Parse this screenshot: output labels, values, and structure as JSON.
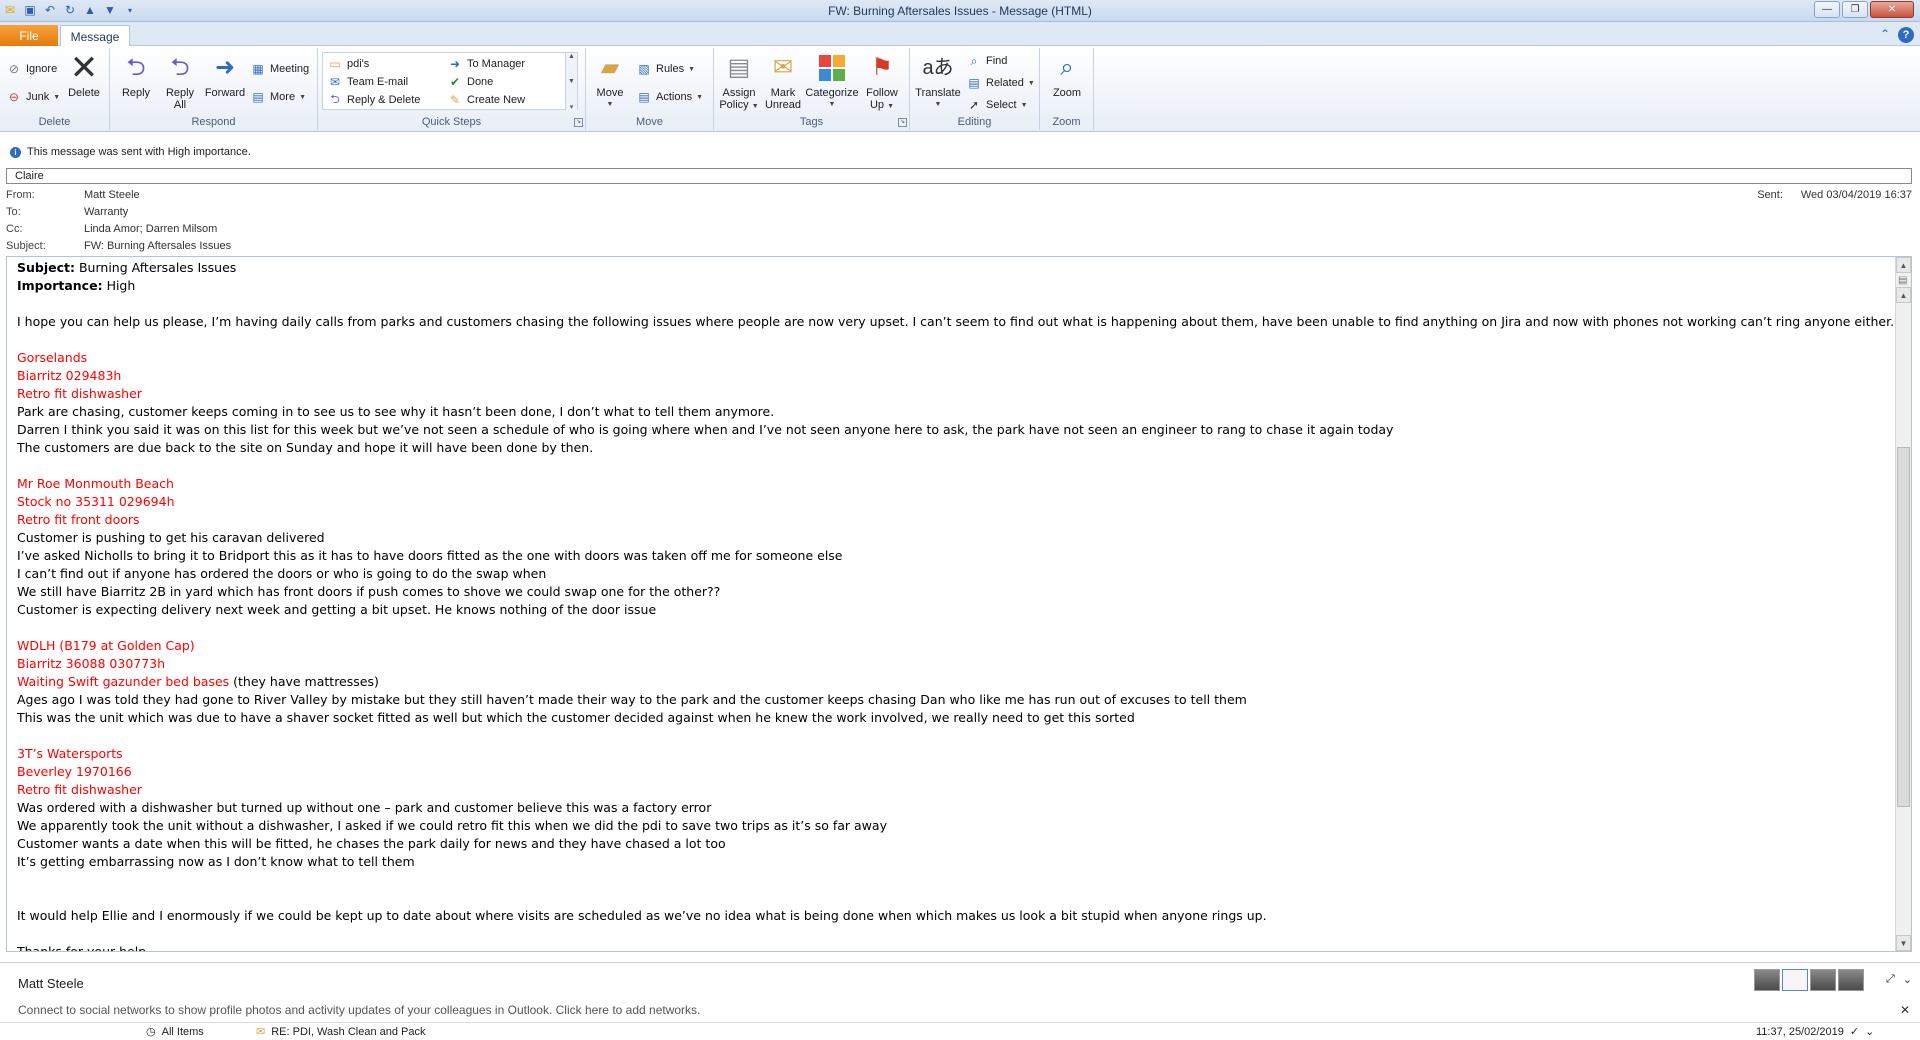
{
  "window": {
    "title": "FW: Burning Aftersales Issues  -  Message (HTML)"
  },
  "tabs": {
    "file": "File",
    "message": "Message"
  },
  "ribbon": {
    "delete_group": {
      "label": "Delete",
      "ignore": "Ignore",
      "junk": "Junk",
      "delete": "Delete"
    },
    "respond_group": {
      "label": "Respond",
      "reply": "Reply",
      "reply_all_1": "Reply",
      "reply_all_2": "All",
      "forward": "Forward",
      "meeting": "Meeting",
      "more": "More"
    },
    "quick_steps_group": {
      "label": "Quick Steps",
      "pdis": "pdi's",
      "to_manager": "To Manager",
      "team_email": "Team E-mail",
      "done": "Done",
      "reply_delete": "Reply & Delete",
      "create_new": "Create New"
    },
    "move_group": {
      "label": "Move",
      "move": "Move",
      "rules": "Rules",
      "actions": "Actions"
    },
    "tags_group": {
      "label": "Tags",
      "assign_policy_1": "Assign",
      "assign_policy_2": "Policy",
      "mark_unread_1": "Mark",
      "mark_unread_2": "Unread",
      "categorize": "Categorize",
      "follow_up_1": "Follow",
      "follow_up_2": "Up"
    },
    "editing_group": {
      "label": "Editing",
      "translate": "Translate",
      "find": "Find",
      "related": "Related",
      "select": "Select"
    },
    "zoom_group": {
      "label": "Zoom",
      "zoom": "Zoom"
    }
  },
  "infobar": {
    "text": "This message was sent with High importance."
  },
  "tag_field": "Claire",
  "headers": {
    "from_label": "From:",
    "from": "Matt Steele",
    "to_label": "To:",
    "to": "Warranty",
    "cc_label": "Cc:",
    "cc": "Linda Amor; Darren Milsom",
    "subject_label": "Subject:",
    "subject": "FW: Burning Aftersales Issues",
    "sent_label": "Sent:",
    "sent": "Wed 03/04/2019 16:37"
  },
  "body": {
    "subject_label": "Subject:",
    "subject": "Burning Aftersales Issues",
    "importance_label": "Importance:",
    "importance": "High",
    "intro": "I hope you can help us please, I’m having daily calls from parks and customers chasing the following issues where people are now very upset.   I can’t seem to find out what is happening about them, have been unable to find anything on Jira and now with phones not working can’t ring anyone either.",
    "issue1": {
      "park": "Gorselands",
      "unit": "Biarritz 029483h",
      "task": "Retro fit dishwasher",
      "lines": [
        "Park are chasing, customer keeps coming in to see us to see why it hasn’t been done, I don’t what to tell them anymore.",
        "Darren I think you said it was on this list for this week but we’ve not seen a schedule of who is going where when and  I’ve not seen anyone here to ask, the park have not seen an engineer to rang to chase it again today",
        "The customers are due back to the site on Sunday and hope it will have been done by then."
      ]
    },
    "issue2": {
      "park": "Mr Roe Monmouth Beach",
      "unit": "Stock no 35311 029694h",
      "task": "Retro fit front doors",
      "lines": [
        "Customer is pushing to get his caravan delivered",
        "I’ve asked Nicholls to bring it to Bridport this as it has to have doors fitted as the one with doors was taken off me for someone else",
        "I can’t find out if anyone has ordered the doors or who is going to do the swap when",
        "We still have Biarritz 2B in yard which has front doors if push comes to shove we could swap one for the other??",
        "Customer is expecting delivery next week and getting a bit upset.  He knows nothing of the door issue"
      ]
    },
    "issue3": {
      "park": "WDLH (B179 at Golden Cap)",
      "unit": "Biarritz 36088 030773h",
      "task": "Waiting Swift gazunder bed bases",
      "task_suffix": " (they have mattresses)",
      "lines": [
        "Ages ago I was told they had gone to River Valley by mistake but they still haven’t made their way to the park and the customer keeps chasing Dan who like me has run out of excuses to tell them",
        "This was the unit which was due to have a shaver socket fitted as well but which the customer decided against when he knew the work involved, we really need to get this sorted"
      ]
    },
    "issue4": {
      "park": "3T’s Watersports",
      "unit": "Beverley 1970166",
      "task": "Retro fit dishwasher",
      "lines": [
        "Was ordered with a dishwasher but turned up without one – park and customer believe this was a factory error",
        "We apparently took the unit without a dishwasher, I asked if we could retro fit this when we did the pdi to save two trips as it’s so far away",
        "Customer wants a date when this will be fitted, he chases the park daily for news and they have chased a lot too",
        "It’s getting embarrassing now as I don’t know what to tell them"
      ]
    },
    "closing": "It would help Ellie and I enormously if we could be kept up to date about where visits are scheduled as we’ve no idea what is being done when which makes us look a bit stupid when anyone rings up.",
    "thanks": "Thanks for your help"
  },
  "people_pane": {
    "name": "Matt Steele",
    "note": "Connect to social networks to show profile photos and activity updates of your colleagues in Outlook. Click here to add networks."
  },
  "status_strip": {
    "folder": "All Items",
    "message_subject": "RE: PDI, Wash Clean and Pack",
    "time": "11:37, 25/02/2019"
  }
}
